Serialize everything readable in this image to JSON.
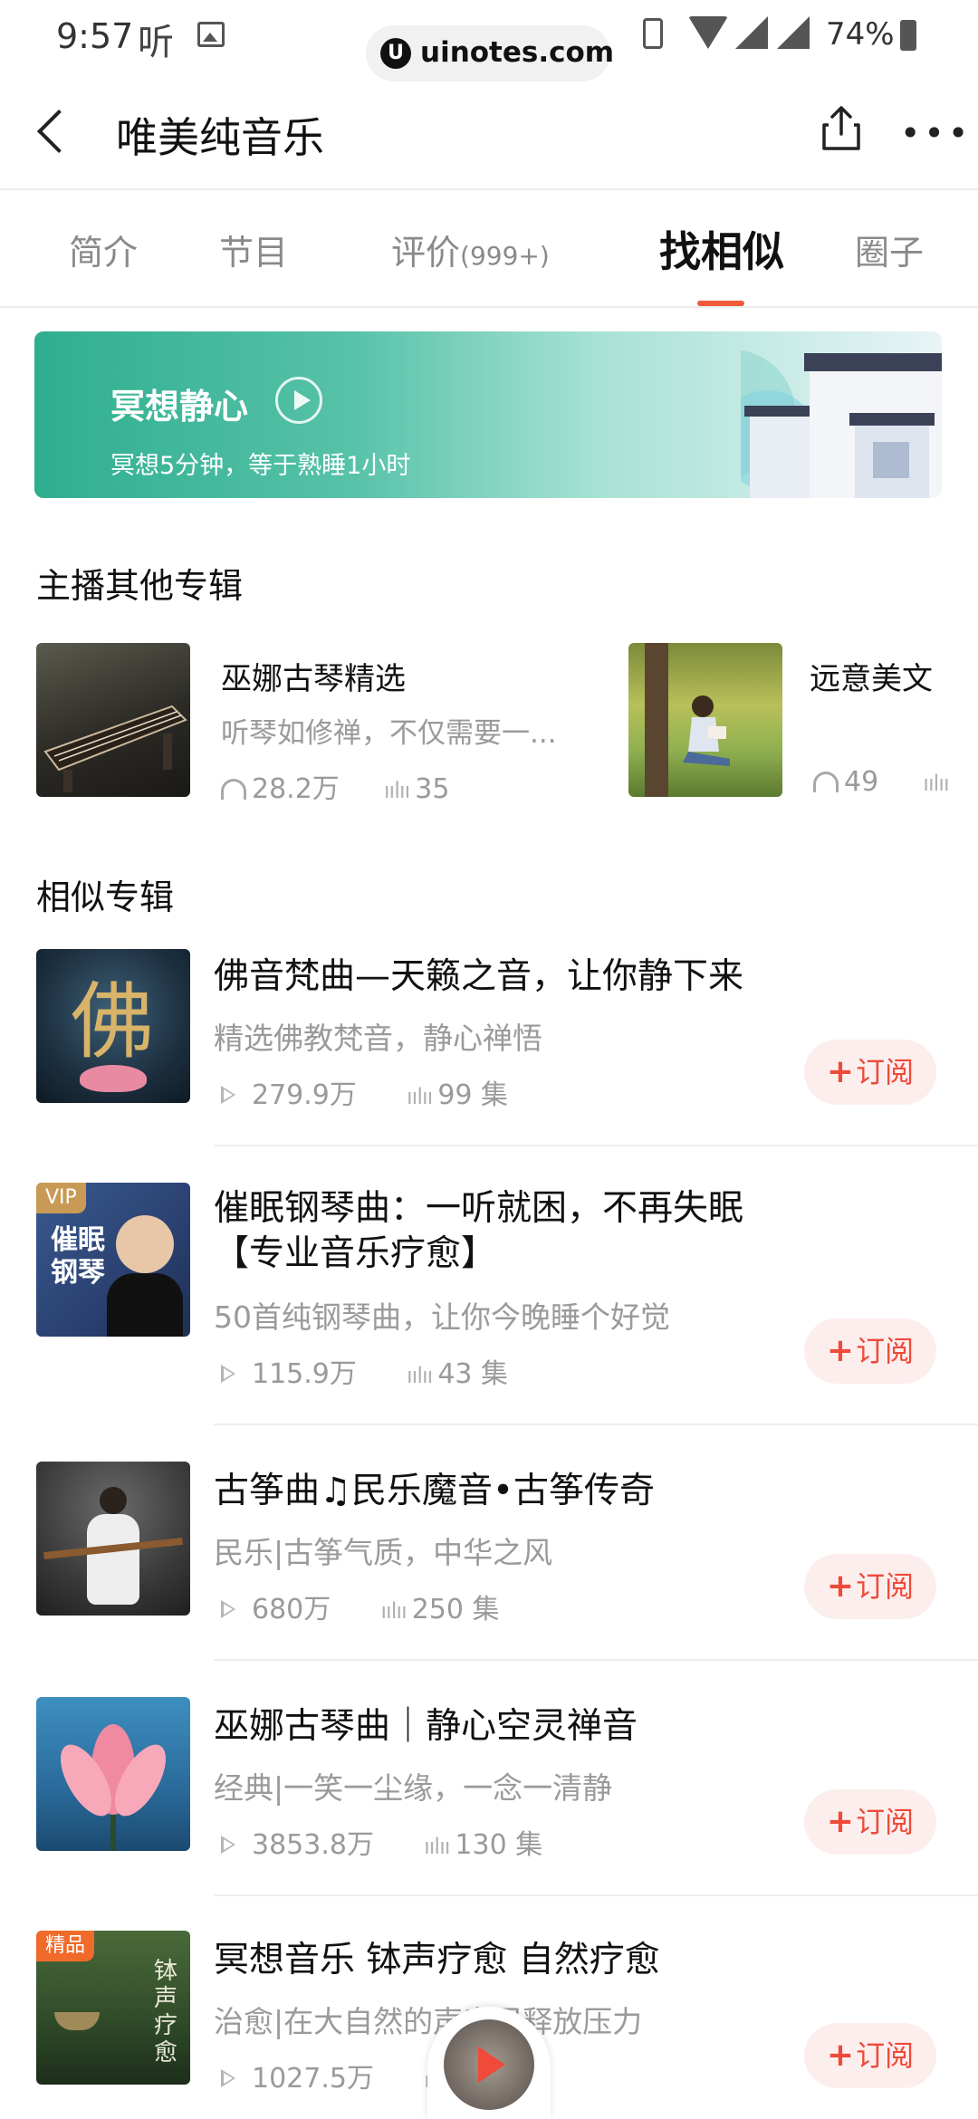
{
  "status": {
    "time": "9:57",
    "ting": "听",
    "url": "uinotes.com",
    "battery": "74%"
  },
  "header": {
    "title": "唯美纯音乐"
  },
  "tabs": [
    {
      "label": "简介"
    },
    {
      "label": "节目"
    },
    {
      "label": "评价",
      "count": "(999+)"
    },
    {
      "label": "找相似"
    },
    {
      "label": "圈子"
    }
  ],
  "banner": {
    "title": "冥想静心",
    "subtitle": "冥想5分钟，等于熟睡1小时"
  },
  "host_section": {
    "title": "主播其他专辑",
    "items": [
      {
        "name": "巫娜古琴精选",
        "desc": "听琴如修禅，不仅需要一...",
        "plays": "28.2万",
        "tracks": "35"
      },
      {
        "name": "远意美文",
        "plays": "49"
      }
    ]
  },
  "similar_section": {
    "title": "相似专辑",
    "subscribe_label": "订阅",
    "items": [
      {
        "title": "佛音梵曲—天籁之音，让你静下来",
        "desc": "精选佛教梵音，静心禅悟",
        "plays": "279.9万",
        "tracks": "99 集",
        "cover_text": "佛"
      },
      {
        "title": "催眠钢琴曲：一听就困，不再失眠【专业音乐疗愈】",
        "desc": "50首纯钢琴曲，让你今晚睡个好觉",
        "plays": "115.9万",
        "tracks": "43 集",
        "badge": "VIP",
        "cover_text": "催眠钢琴"
      },
      {
        "title": "古筝曲♫民乐魔音•古筝传奇",
        "desc": "民乐|古筝气质，中华之风",
        "plays": "680万",
        "tracks": "250 集"
      },
      {
        "title": "巫娜古琴曲｜静心空灵禅音",
        "desc": "经典|一笑一尘缘，一念一清静",
        "plays": "3853.8万",
        "tracks": "130 集"
      },
      {
        "title": "冥想音乐 钵声疗愈 自然疗愈",
        "desc": "治愈|在大自然的声音里释放压力",
        "plays": "1027.5万",
        "tracks": "",
        "badge": "精品",
        "cover_text": "钵声疗愈"
      }
    ]
  },
  "colors": {
    "accent": "#f05a3a",
    "subscribe_bg": "#fdeeee",
    "subscribe_text": "#ef4a3a"
  }
}
